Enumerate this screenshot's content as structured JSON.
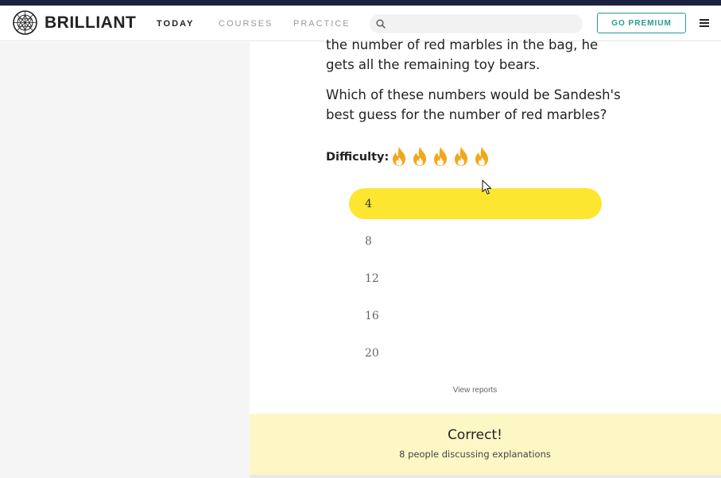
{
  "header": {
    "logo_text": "BRILLIANT",
    "nav": [
      {
        "label": "TODAY",
        "active": true
      },
      {
        "label": "COURSES",
        "active": false
      },
      {
        "label": "PRACTICE",
        "active": false
      }
    ],
    "search_placeholder": "",
    "premium_label": "GO PREMIUM",
    "accent_color": "#239d8c"
  },
  "problem": {
    "text_partial": "the number of red marbles in the bag, he gets all the remaining toy bears.",
    "question": "Which of these numbers would be Sandesh's best guess for the number of red marbles?",
    "difficulty_label": "Difficulty:",
    "difficulty_level": 5,
    "difficulty_icon": "flame-icon",
    "options": [
      {
        "label": "4",
        "selected": true
      },
      {
        "label": "8",
        "selected": false
      },
      {
        "label": "12",
        "selected": false
      },
      {
        "label": "16",
        "selected": false
      },
      {
        "label": "20",
        "selected": false
      }
    ],
    "selected_color": "#fde62f"
  },
  "view_reports": "View reports",
  "result": {
    "title": "Correct!",
    "subtitle": "8 people discussing explanations"
  }
}
